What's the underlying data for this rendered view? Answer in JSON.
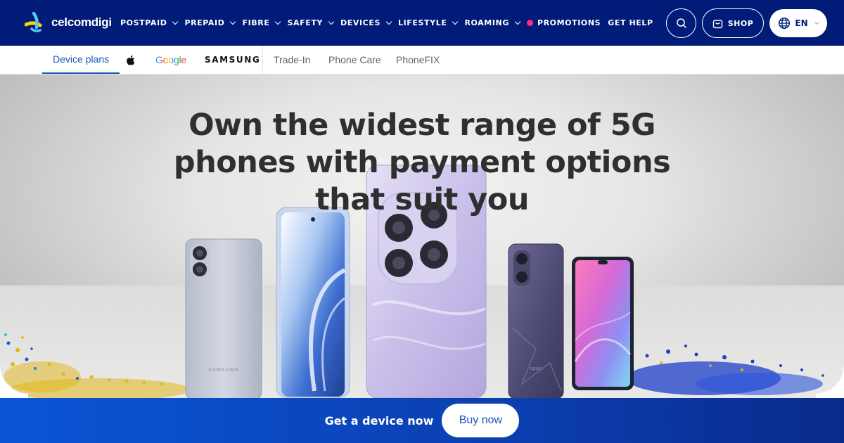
{
  "header": {
    "logo_text": "celcomdigi",
    "menu": [
      {
        "label": "POSTPAID",
        "has_dropdown": true
      },
      {
        "label": "PREPAID",
        "has_dropdown": true
      },
      {
        "label": "FIBRE",
        "has_dropdown": true
      },
      {
        "label": "SAFETY",
        "has_dropdown": true
      },
      {
        "label": "DEVICES",
        "has_dropdown": true
      },
      {
        "label": "LIFESTYLE",
        "has_dropdown": true
      },
      {
        "label": "ROAMING",
        "has_dropdown": true
      },
      {
        "label": "PROMOTIONS",
        "has_dropdown": false
      },
      {
        "label": "GET HELP",
        "has_dropdown": false
      }
    ],
    "search_icon": "search-icon",
    "shop_label": "SHOP",
    "language_label": "EN",
    "colors": {
      "nav_bg": "#001b78",
      "promo_dot": "#ff2d7a"
    }
  },
  "subnav": {
    "tabs": [
      {
        "label": "Device plans",
        "active": true
      },
      {
        "label": "",
        "icon": "apple-logo-icon"
      },
      {
        "label": "Google"
      },
      {
        "label": "SAMSUNG"
      },
      {
        "label": "Trade-In"
      },
      {
        "label": "Phone Care"
      },
      {
        "label": "PhoneFIX"
      }
    ]
  },
  "hero": {
    "title": "Own the widest range of 5G phones with payment options that suit you",
    "device_brand_text": "SAMSUNG",
    "device_brand_text_2": "oppo"
  },
  "cta": {
    "text": "Get a device now",
    "button_label": "Buy now",
    "colors": {
      "start": "#0a55d6",
      "end": "#0a2b8c",
      "button_text": "#1a56b8"
    }
  }
}
